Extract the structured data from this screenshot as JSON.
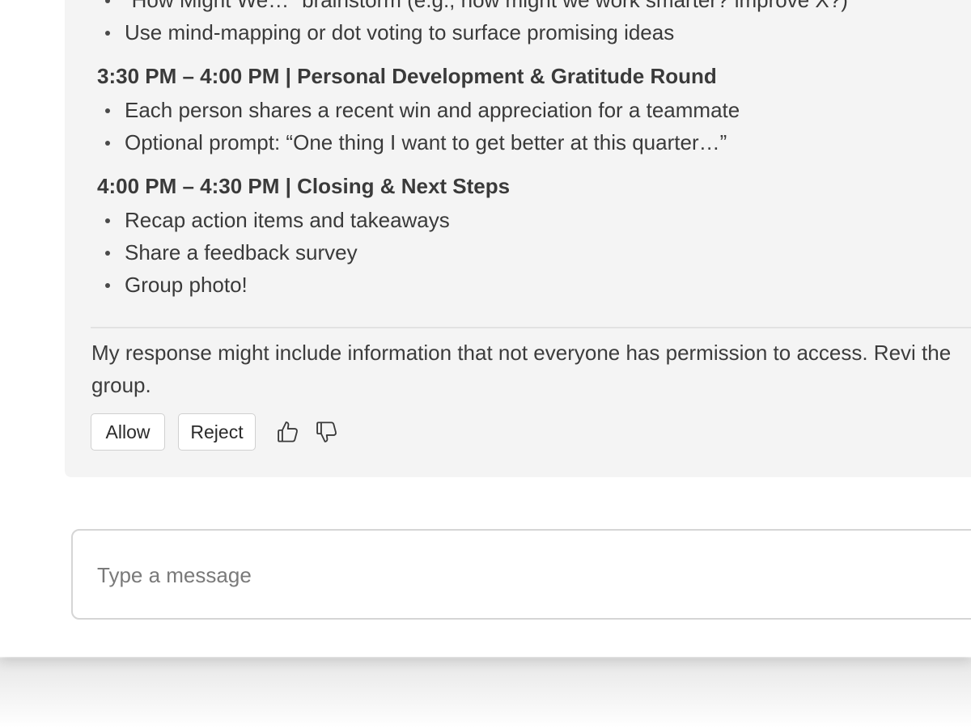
{
  "agenda": {
    "top_bullets": [
      "“How Might We…” brainstorm (e.g., how might we work smarter? improve X?)",
      "Use mind-mapping or dot voting to surface promising ideas"
    ],
    "sections": [
      {
        "heading": "3:30 PM – 4:00 PM | Personal Development & Gratitude Round",
        "bullets": [
          "Each person shares a recent win and appreciation for a teammate",
          "Optional prompt: “One thing I want to get better at this quarter…”"
        ]
      },
      {
        "heading": "4:00 PM – 4:30 PM | Closing & Next Steps",
        "bullets": [
          "Recap action items and takeaways",
          "Share a feedback survey",
          "Group photo!"
        ]
      }
    ]
  },
  "disclaimer": {
    "text": "My response might include information that not everyone has permission to access. Revi the group."
  },
  "actions": {
    "allow_label": "Allow",
    "reject_label": "Reject",
    "like_icon": "thumbs-up-icon",
    "dislike_icon": "thumbs-down-icon"
  },
  "composer": {
    "placeholder": "Type a message",
    "value": ""
  }
}
